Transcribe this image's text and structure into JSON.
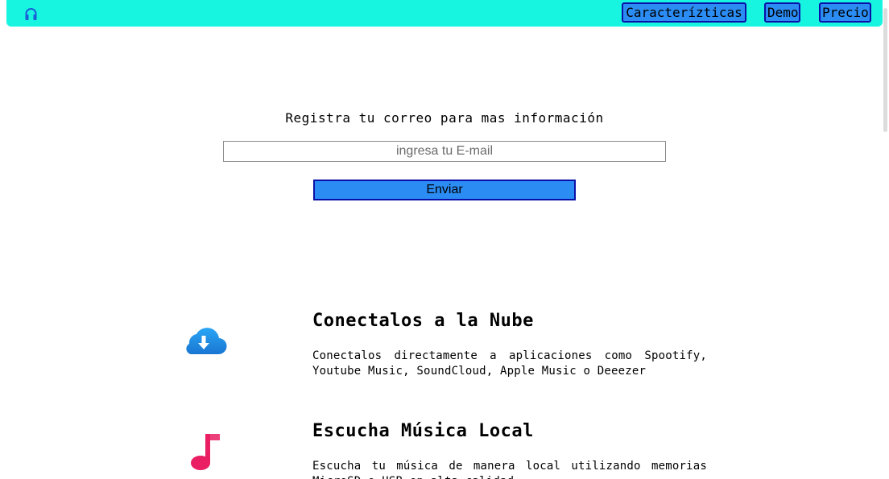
{
  "nav": {
    "logo_icon": "headphones-icon",
    "links": [
      {
        "label": "Caracterízticas"
      },
      {
        "label": "Demo"
      },
      {
        "label": "Precio"
      }
    ]
  },
  "signup": {
    "title": "Registra tu correo para mas información",
    "email_placeholder": "ingresa tu E-mail",
    "email_value": "",
    "submit_label": "Enviar"
  },
  "features": [
    {
      "icon": "cloud-download-icon",
      "title": "Conectalos a la Nube",
      "text": "Conectalos directamente a aplicaciones como Spootify, Youtube Music, SoundCloud, Apple Music o Deeezer"
    },
    {
      "icon": "music-note-icon",
      "title": "Escucha Música Local",
      "text": "Escucha tu música de manera local utilizando memorias MicroSD o USB en alta calidad"
    }
  ],
  "colors": {
    "navbar": "#17f5e1",
    "button": "#2b8cf3",
    "button_border": "#0a0fa8",
    "cloud": "#2196f3",
    "note": "#e91e63"
  }
}
